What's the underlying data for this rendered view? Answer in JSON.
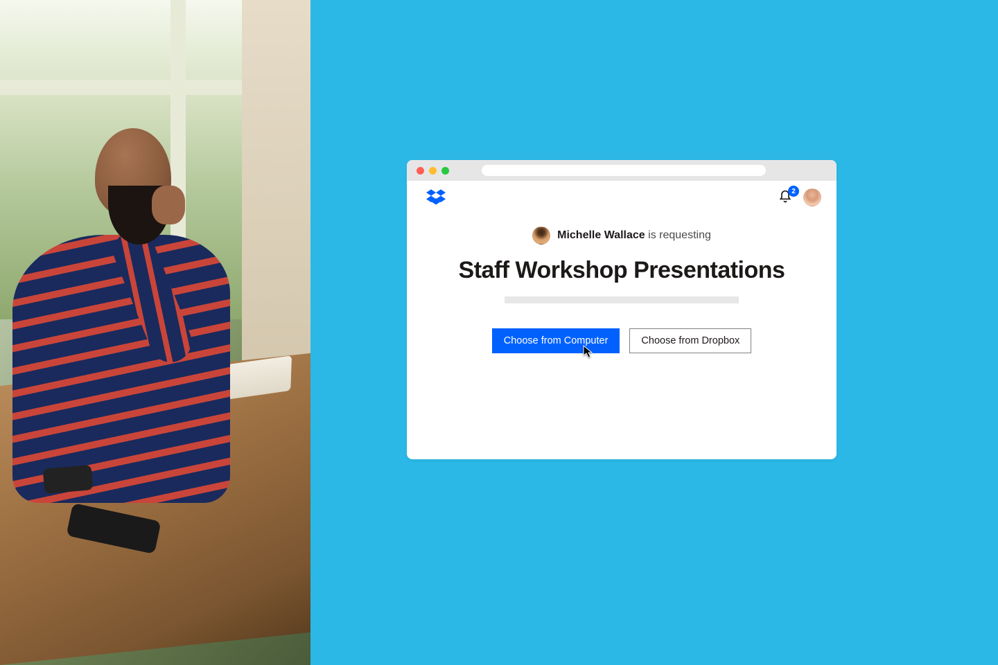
{
  "colors": {
    "background_cyan": "#2bb8e6",
    "primary_blue": "#0061ff",
    "text_dark": "#1e1919"
  },
  "header": {
    "logo_name": "dropbox-logo",
    "notification_count": "2",
    "avatar_name": "user-avatar"
  },
  "request": {
    "requester_name": "Michelle Wallace",
    "requesting_label": "is requesting",
    "title": "Staff Workshop Presentations"
  },
  "buttons": {
    "choose_computer": "Choose from Computer",
    "choose_dropbox": "Choose from Dropbox"
  }
}
